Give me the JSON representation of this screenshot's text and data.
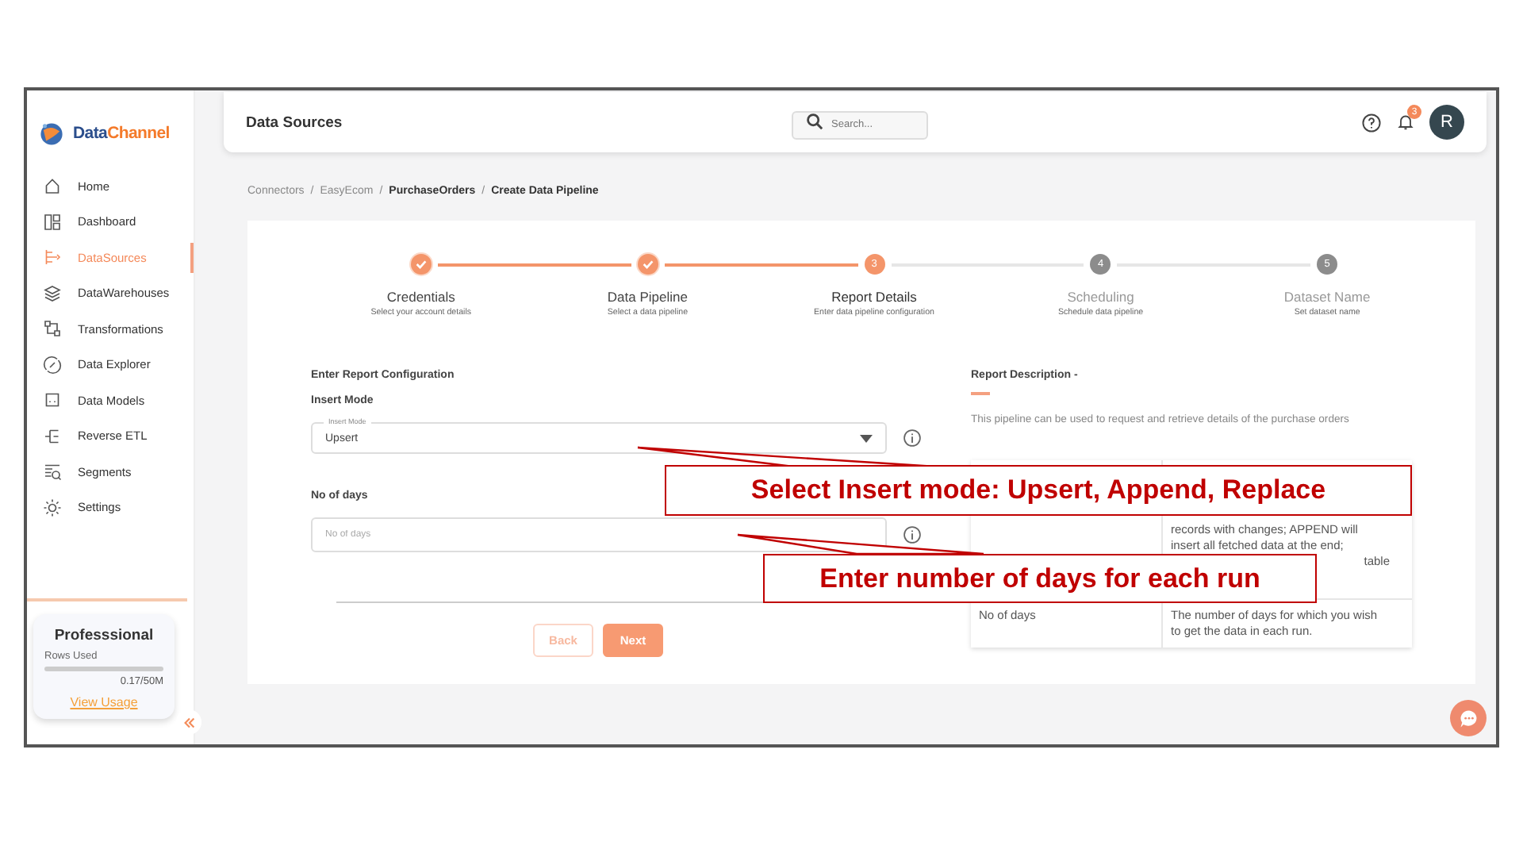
{
  "sidebar": {
    "logo": {
      "part_1": "Data",
      "part_2": "Channel"
    },
    "items": [
      {
        "label": "Home",
        "selected": false
      },
      {
        "label": "Dashboard",
        "selected": false
      },
      {
        "label": "DataSources",
        "selected": true
      },
      {
        "label": "DataWarehouses",
        "selected": false
      },
      {
        "label": "Transformations",
        "selected": false
      },
      {
        "label": "Data Explorer",
        "selected": false
      },
      {
        "label": "Data Models",
        "selected": false
      },
      {
        "label": "Reverse ETL",
        "selected": false
      },
      {
        "label": "Segments",
        "selected": false
      },
      {
        "label": "Settings",
        "selected": false
      }
    ],
    "plan": {
      "title": "Professsional",
      "rows_label": "Rows Used",
      "usage": "0.17/50M",
      "link": "View Usage"
    }
  },
  "header": {
    "title": "Data Sources",
    "search": {
      "placeholder": "Search..."
    },
    "notification_count": "3",
    "avatar": "R"
  },
  "breadcrumb": {
    "separator": "/",
    "items": [
      {
        "label": "Connectors",
        "kind": "link"
      },
      {
        "label": "EasyEcom",
        "kind": "link"
      },
      {
        "label": "PurchaseOrders",
        "kind": "current"
      },
      {
        "label": "Create Data Pipeline",
        "kind": "current"
      }
    ]
  },
  "stepper": [
    {
      "title": "Credentials",
      "subtitle": "Select your account details",
      "done": true,
      "active": false
    },
    {
      "title": "Data Pipeline",
      "subtitle": "Select a data pipeline",
      "done": true,
      "active": false
    },
    {
      "title": "Report Details",
      "subtitle": "Enter data pipeline configuration",
      "done": false,
      "active": true,
      "number": "3"
    },
    {
      "title": "Scheduling",
      "subtitle": "Schedule data pipeline",
      "done": false,
      "active": false,
      "number": "4"
    },
    {
      "title": "Dataset Name",
      "subtitle": "Set dataset name",
      "done": false,
      "active": false,
      "number": "5"
    }
  ],
  "form": {
    "heading": "Enter Report Configuration",
    "fields": [
      {
        "kind": "select",
        "label": "Insert Mode",
        "floating_label": "Insert Mode",
        "value": "Upsert"
      },
      {
        "kind": "text",
        "label": "No of days",
        "placeholder": "No of days"
      }
    ],
    "buttons": [
      {
        "label": "Back",
        "kind": "secondary"
      },
      {
        "label": "Next",
        "kind": "primary"
      }
    ]
  },
  "description": {
    "title": "Report Description -",
    "text": "This pipeline can be used to request and retrieve details of the purchase orders",
    "table": {
      "rows": [
        {
          "lines": [
            "records with changes; APPEND will",
            "insert all fetched data at the end;"
          ],
          "fragment": "table"
        },
        {
          "parameter": "No of days",
          "lines": [
            "The number of days for which you wish",
            "to get the data in each run."
          ]
        }
      ]
    }
  },
  "annotations": [
    {
      "text": "Select Insert mode: Upsert, Append, Replace"
    },
    {
      "text": "Enter number of days for each run"
    }
  ]
}
